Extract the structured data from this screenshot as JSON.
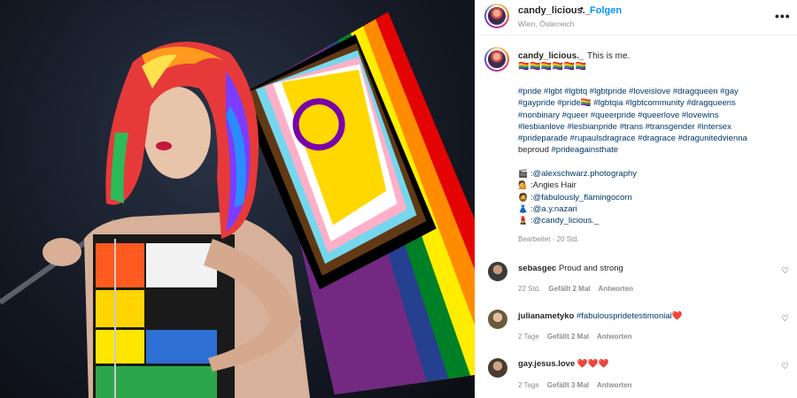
{
  "header": {
    "username": "candy_licious._",
    "separator": "•",
    "follow_label": "Folgen",
    "location": "Wien, Österreich",
    "more_icon": "•••"
  },
  "caption": {
    "username": "candy_licious._",
    "text": "This is me.",
    "emojis": "🏳️‍🌈🏳️‍🌈🏳️‍🌈🏳️‍🌈🏳️‍🌈🏳️‍🌈",
    "hashtags_line1": "#pride #lgbt #lgbtq #lgbtpride #loveislove #dragqueen #gay",
    "hashtags_line2": "#gaypride #pride🏳️‍🌈 #lgbtqia #lgbtcommunity #dragqueens",
    "hashtags_line3": "#nonbinary #queer #queerpride #queerlove #lovewins",
    "hashtags_line4": "#lesbianlove #lesbianpride #trans #transgender #intersex",
    "hashtags_line5": "#prideparade #rupaulsdragrace #dragrace #dragunitedvienna",
    "hashtags_line6_plain": "beproud",
    "hashtags_line6_tag": "#prideagainsthate",
    "edited": "Bearbeitet · 20 Std."
  },
  "credits": [
    {
      "icon": "🎬",
      "sep": ": ",
      "text": "@alexschwarz.photography",
      "link": true
    },
    {
      "icon": "💁",
      "sep": ": ",
      "text": "Angies Hair",
      "link": false
    },
    {
      "icon": "🧔",
      "sep": ": ",
      "text": "@fabulously_flamingocorn",
      "link": true
    },
    {
      "icon": "👗",
      "sep": ": ",
      "text": "@a.y.nazari",
      "link": true
    },
    {
      "icon": "💄",
      "sep": ": ",
      "text": "@candy_licious._",
      "link": true
    }
  ],
  "comments": [
    {
      "username": "sebasgec",
      "text": "Proud and strong",
      "time": "22 Std.",
      "likes": "Gefällt 2 Mal",
      "reply": "Antworten"
    },
    {
      "username": "julianametyko",
      "text": "#fabulouspridetestimonial❤️",
      "time": "2 Tage",
      "likes": "Gefällt 2 Mal",
      "reply": "Antworten"
    },
    {
      "username": "gay.jesus.love",
      "text": "❤️❤️❤️",
      "time": "2 Tage",
      "likes": "Gefällt 3 Mal",
      "reply": "Antworten"
    }
  ],
  "heart_icon": "♡",
  "colors": {
    "accent_link": "#0095f6",
    "hashtag": "#00376b",
    "muted": "#8e8e8e",
    "text": "#262626"
  }
}
